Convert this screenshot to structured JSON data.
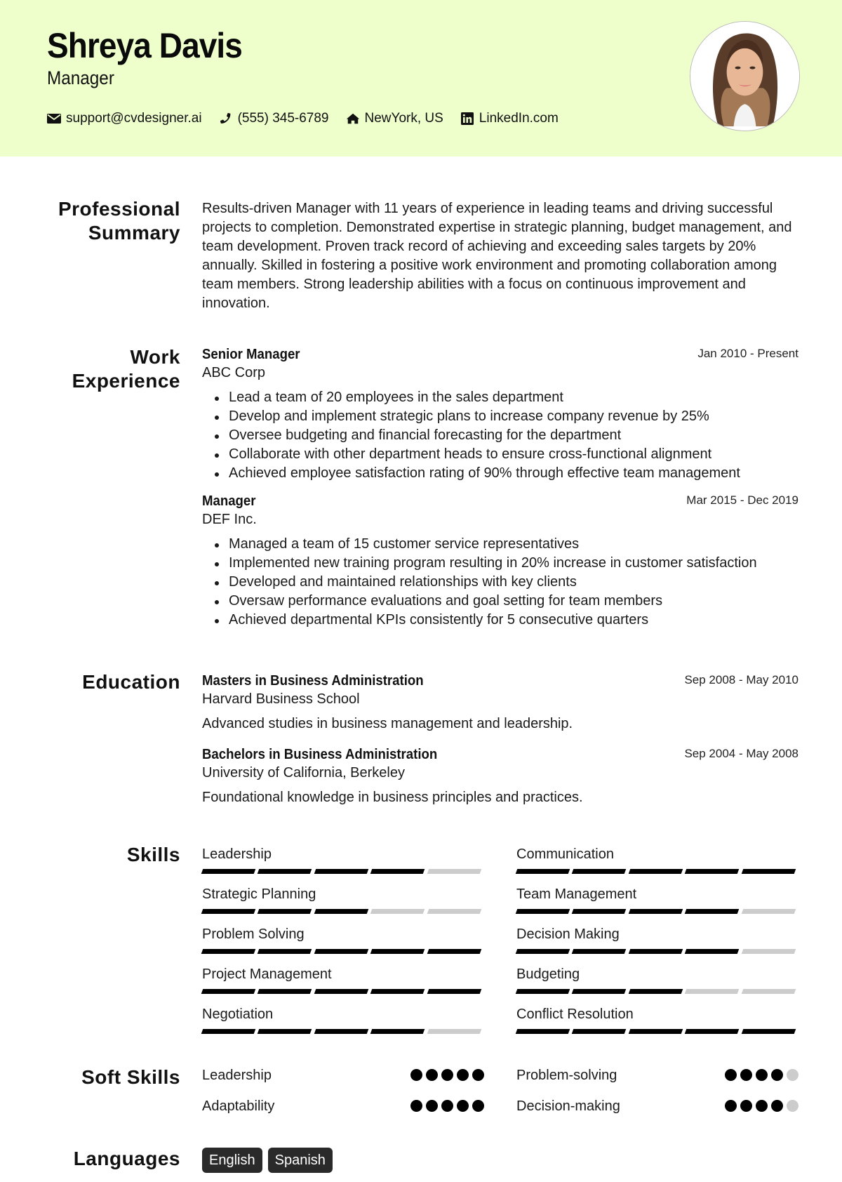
{
  "header": {
    "name": "Shreya Davis",
    "role": "Manager",
    "background_color": "#eeffcc",
    "contacts": [
      {
        "icon": "envelope-icon",
        "text": "support@cvdesigner.ai"
      },
      {
        "icon": "phone-icon",
        "text": "(555) 345-6789"
      },
      {
        "icon": "home-icon",
        "text": "NewYork, US"
      },
      {
        "icon": "linkedin-icon",
        "text": "LinkedIn.com"
      }
    ]
  },
  "summary": {
    "title_line1": "Professional",
    "title_line2": "Summary",
    "text": "Results-driven Manager with 11 years of experience in leading teams and driving successful projects to completion. Demonstrated expertise in strategic planning, budget management, and team development. Proven track record of achieving and exceeding sales targets by 20% annually. Skilled in fostering a positive work environment and promoting collaboration among team members. Strong leadership abilities with a focus on continuous improvement and innovation."
  },
  "experience": {
    "title_line1": "Work",
    "title_line2": "Experience",
    "jobs": [
      {
        "title": "Senior Manager",
        "company": "ABC Corp",
        "dates": "Jan 2010 - Present",
        "bullets": [
          "Lead a team of 20 employees in the sales department",
          "Develop and implement strategic plans to increase company revenue by 25%",
          "Oversee budgeting and financial forecasting for the department",
          "Collaborate with other department heads to ensure cross-functional alignment",
          "Achieved employee satisfaction rating of 90% through effective team management"
        ]
      },
      {
        "title": "Manager",
        "company": "DEF Inc.",
        "dates": "Mar 2015 - Dec 2019",
        "bullets": [
          "Managed a team of 15 customer service representatives",
          "Implemented new training program resulting in 20% increase in customer satisfaction",
          "Developed and maintained relationships with key clients",
          "Oversaw performance evaluations and goal setting for team members",
          "Achieved departmental KPIs consistently for 5 consecutive quarters"
        ]
      }
    ]
  },
  "education": {
    "title": "Education",
    "items": [
      {
        "degree": "Masters in Business Administration",
        "school": "Harvard Business School",
        "dates": "Sep 2008 - May 2010",
        "description": "Advanced studies in business management and leadership."
      },
      {
        "degree": "Bachelors in Business Administration",
        "school": "University of California, Berkeley",
        "dates": "Sep 2004 - May 2008",
        "description": "Foundational knowledge in business principles and practices."
      }
    ]
  },
  "skills": {
    "title": "Skills",
    "max_level": 5,
    "items": [
      {
        "name": "Leadership",
        "level": 4
      },
      {
        "name": "Communication",
        "level": 5
      },
      {
        "name": "Strategic Planning",
        "level": 3
      },
      {
        "name": "Team Management",
        "level": 4
      },
      {
        "name": "Problem Solving",
        "level": 5
      },
      {
        "name": "Decision Making",
        "level": 4
      },
      {
        "name": "Project Management",
        "level": 5
      },
      {
        "name": "Budgeting",
        "level": 3
      },
      {
        "name": "Negotiation",
        "level": 4
      },
      {
        "name": "Conflict Resolution",
        "level": 5
      }
    ]
  },
  "soft_skills": {
    "title": "Soft Skills",
    "max_level": 5,
    "items": [
      {
        "name": "Leadership",
        "level": 5
      },
      {
        "name": "Problem-solving",
        "level": 4
      },
      {
        "name": "Adaptability",
        "level": 5
      },
      {
        "name": "Decision-making",
        "level": 4
      }
    ]
  },
  "languages": {
    "title": "Languages",
    "items": [
      "English",
      "Spanish"
    ]
  }
}
